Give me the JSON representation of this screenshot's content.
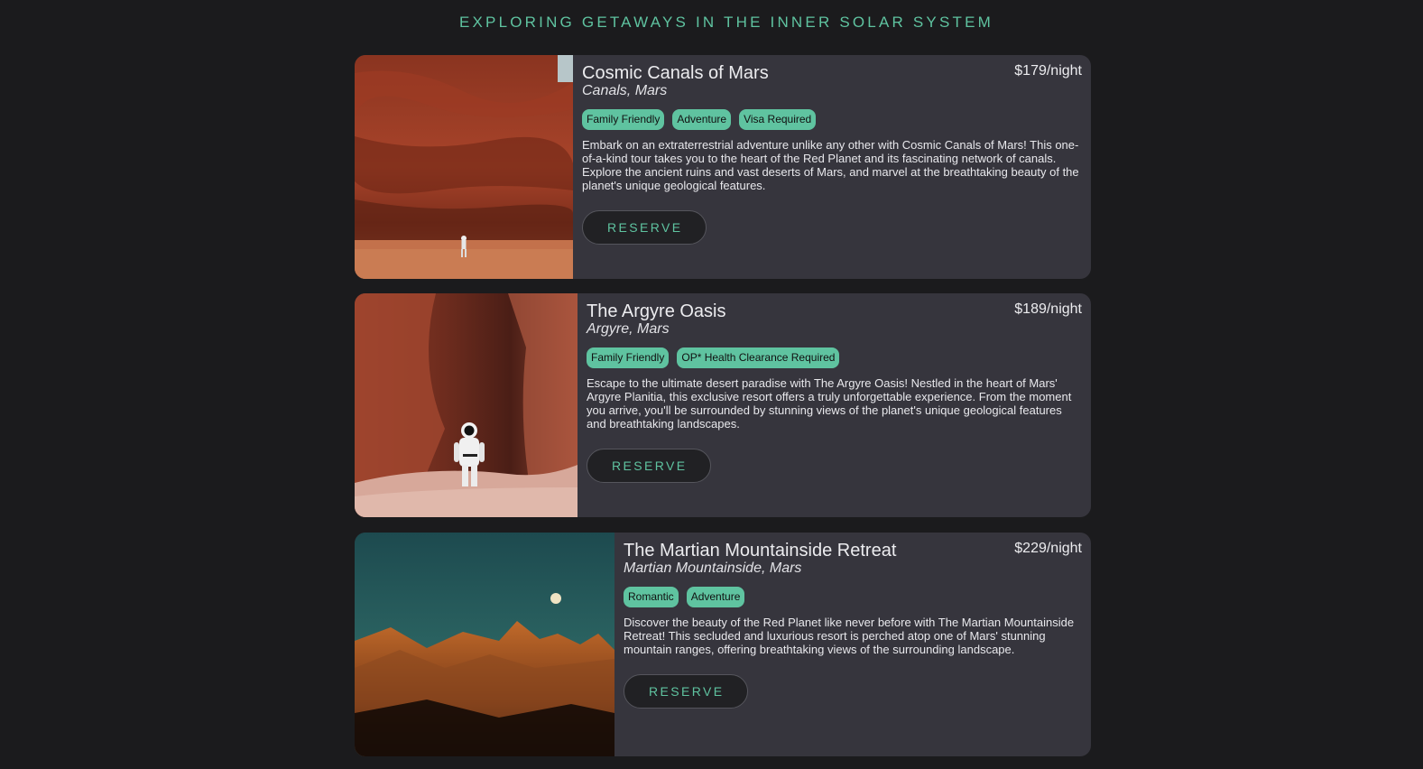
{
  "header": {
    "title": "EXPLORING GETAWAYS IN THE INNER SOLAR SYSTEM"
  },
  "listings": [
    {
      "name": "Cosmic Canals of Mars",
      "location": "Canals, Mars",
      "price": "$179/night",
      "tags": [
        "Family Friendly",
        "Adventure",
        "Visa Required"
      ],
      "description": "Embark on an extraterrestrial adventure unlike any other with Cosmic Canals of Mars! This one-of-a-kind tour takes you to the heart of the Red Planet and its fascinating network of canals. Explore the ancient ruins and vast deserts of Mars, and marvel at the breathtaking beauty of the planet's unique geological features.",
      "reserve_label": "RESERVE"
    },
    {
      "name": "The Argyre Oasis",
      "location": "Argyre, Mars",
      "price": "$189/night",
      "tags": [
        "Family Friendly",
        "OP* Health Clearance Required"
      ],
      "description": "Escape to the ultimate desert paradise with The Argyre Oasis! Nestled in the heart of Mars' Argyre Planitia, this exclusive resort offers a truly unforgettable experience. From the moment you arrive, you'll be surrounded by stunning views of the planet's unique geological features and breathtaking landscapes.",
      "reserve_label": "RESERVE"
    },
    {
      "name": "The Martian Mountainside Retreat",
      "location": "Martian Mountainside, Mars",
      "price": "$229/night",
      "tags": [
        "Romantic",
        "Adventure"
      ],
      "description": "Discover the beauty of the Red Planet like never before with The Martian Mountainside Retreat! This secluded and luxurious resort is perched atop one of Mars' stunning mountain ranges, offering breathtaking views of the surrounding landscape.",
      "reserve_label": "RESERVE"
    }
  ],
  "colors": {
    "background": "#1b1b1d",
    "card": "#36353d",
    "accent": "#5fc3a0",
    "button": "#212124"
  }
}
